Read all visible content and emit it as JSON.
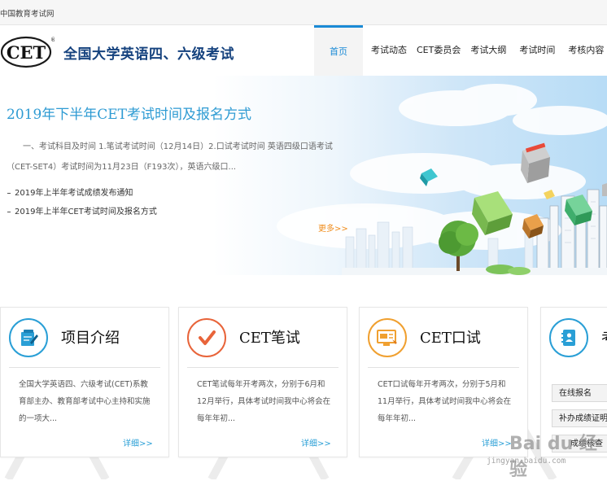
{
  "topbar": {
    "site_name": "中国教育考试网"
  },
  "header": {
    "logo_text": "CET",
    "logo_reg": "®",
    "title": "全国大学英语四、六级考试"
  },
  "nav": {
    "items": [
      {
        "label": "首页",
        "active": true
      },
      {
        "label": "考试动态"
      },
      {
        "label": "CET委员会"
      },
      {
        "label": "考试大纲"
      },
      {
        "label": "考试时间"
      },
      {
        "label": "考核内容"
      }
    ]
  },
  "banner": {
    "headline": "2019年下半年CET考试时间及报名方式",
    "summary": "一、考试科目及时间   1.笔试考试时间（12月14日）2.口试考试时间   英语四级口语考试（CET-SET4）考试时间为11月23日（F193次），英语六级口...",
    "news": [
      "2019年上半年考试成绩发布通知",
      "2019年上半年CET考试时间及报名方式"
    ],
    "more_label": "更多>>"
  },
  "cards": [
    {
      "title": "项目介绍",
      "icon": "document-edit-icon",
      "desc": "全国大学英语四、六级考试(CET)系教育部主办、教育部考试中心主持和实施的一项大...",
      "more": "详细>>",
      "accent": "#2a9fd6"
    },
    {
      "title": "CET笔试",
      "icon": "checkmark-icon",
      "desc": "CET笔试每年开考两次，分别于6月和12月举行，具体考试时间我中心将会在每年年初...",
      "more": "详细>>",
      "accent": "#e8643a"
    },
    {
      "title": "CET口试",
      "icon": "monitor-chat-icon",
      "desc": "CET口试每年开考两次，分别于5月和11月举行，具体考试时间我中心将会在每年年初...",
      "more": "详细>>",
      "accent": "#f0a030"
    },
    {
      "title": "考",
      "icon": "contact-book-icon",
      "accent": "#2a9fd6"
    }
  ],
  "side_buttons": [
    "在线报名",
    "补办成绩证明",
    "成绩核查"
  ],
  "watermark": {
    "text": "Bai du 经验",
    "url": "jingyan.baidu.com"
  }
}
